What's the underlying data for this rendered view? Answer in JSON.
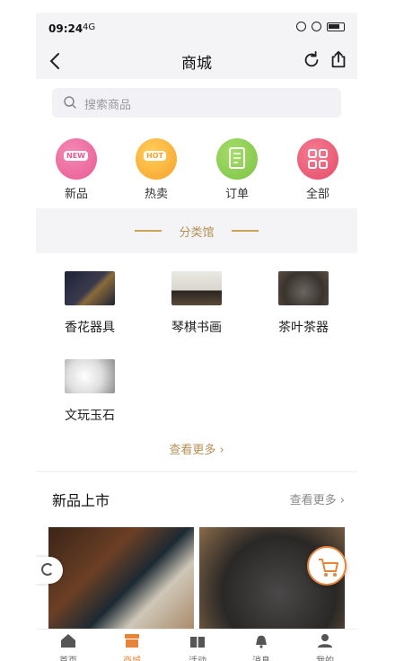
{
  "status": {
    "time": "09:24",
    "signal": "4G"
  },
  "header": {
    "title": "商城"
  },
  "search": {
    "placeholder": "搜索商品"
  },
  "quick_links": [
    {
      "label": "新品",
      "badge": "NEW",
      "icon": "new-icon",
      "color": "#e85a92"
    },
    {
      "label": "热卖",
      "badge": "HOT",
      "icon": "hot-icon",
      "color": "#f7a12a"
    },
    {
      "label": "订单",
      "icon": "order-icon",
      "color": "#7bc443"
    },
    {
      "label": "全部",
      "icon": "grid-icon",
      "color": "#e64b66"
    }
  ],
  "section_divider": {
    "label": "分类馆"
  },
  "categories": [
    {
      "label": "香花器具"
    },
    {
      "label": "琴棋书画"
    },
    {
      "label": "茶叶茶器"
    },
    {
      "label": "文玩玉石"
    }
  ],
  "categories_more": "查看更多",
  "new_arrivals": {
    "title": "新品上市",
    "more": "查看更多"
  },
  "tabs": [
    {
      "label": "首页",
      "icon": "home-icon",
      "active": false
    },
    {
      "label": "商城",
      "icon": "shop-icon",
      "active": true
    },
    {
      "label": "活动",
      "icon": "gift-icon",
      "active": false
    },
    {
      "label": "消息",
      "icon": "bell-icon",
      "active": false
    },
    {
      "label": "我的",
      "icon": "user-icon",
      "active": false
    }
  ],
  "colors": {
    "accent": "#e6843a",
    "gold": "#b49057",
    "background": "#f4f4f6"
  }
}
